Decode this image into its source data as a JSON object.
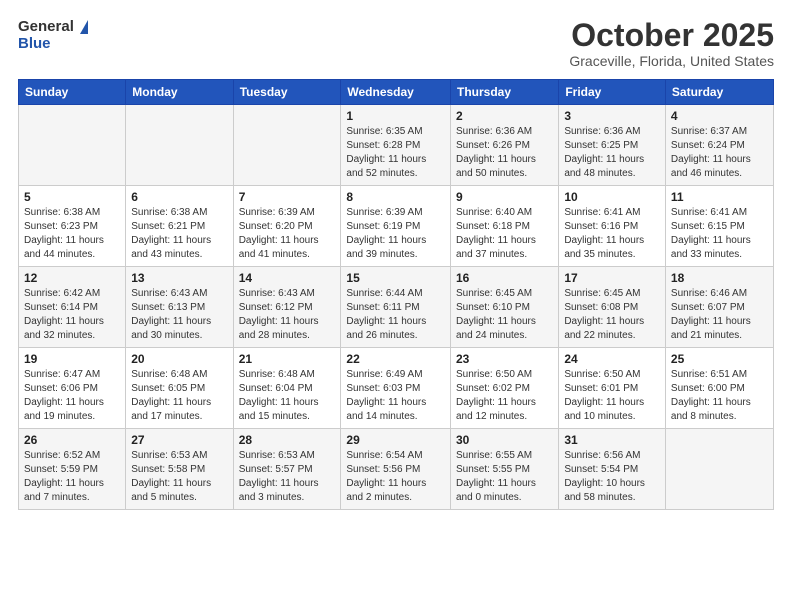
{
  "header": {
    "logo_general": "General",
    "logo_blue": "Blue",
    "month": "October 2025",
    "location": "Graceville, Florida, United States"
  },
  "weekdays": [
    "Sunday",
    "Monday",
    "Tuesday",
    "Wednesday",
    "Thursday",
    "Friday",
    "Saturday"
  ],
  "weeks": [
    [
      {
        "day": "",
        "info": ""
      },
      {
        "day": "",
        "info": ""
      },
      {
        "day": "",
        "info": ""
      },
      {
        "day": "1",
        "info": "Sunrise: 6:35 AM\nSunset: 6:28 PM\nDaylight: 11 hours\nand 52 minutes."
      },
      {
        "day": "2",
        "info": "Sunrise: 6:36 AM\nSunset: 6:26 PM\nDaylight: 11 hours\nand 50 minutes."
      },
      {
        "day": "3",
        "info": "Sunrise: 6:36 AM\nSunset: 6:25 PM\nDaylight: 11 hours\nand 48 minutes."
      },
      {
        "day": "4",
        "info": "Sunrise: 6:37 AM\nSunset: 6:24 PM\nDaylight: 11 hours\nand 46 minutes."
      }
    ],
    [
      {
        "day": "5",
        "info": "Sunrise: 6:38 AM\nSunset: 6:23 PM\nDaylight: 11 hours\nand 44 minutes."
      },
      {
        "day": "6",
        "info": "Sunrise: 6:38 AM\nSunset: 6:21 PM\nDaylight: 11 hours\nand 43 minutes."
      },
      {
        "day": "7",
        "info": "Sunrise: 6:39 AM\nSunset: 6:20 PM\nDaylight: 11 hours\nand 41 minutes."
      },
      {
        "day": "8",
        "info": "Sunrise: 6:39 AM\nSunset: 6:19 PM\nDaylight: 11 hours\nand 39 minutes."
      },
      {
        "day": "9",
        "info": "Sunrise: 6:40 AM\nSunset: 6:18 PM\nDaylight: 11 hours\nand 37 minutes."
      },
      {
        "day": "10",
        "info": "Sunrise: 6:41 AM\nSunset: 6:16 PM\nDaylight: 11 hours\nand 35 minutes."
      },
      {
        "day": "11",
        "info": "Sunrise: 6:41 AM\nSunset: 6:15 PM\nDaylight: 11 hours\nand 33 minutes."
      }
    ],
    [
      {
        "day": "12",
        "info": "Sunrise: 6:42 AM\nSunset: 6:14 PM\nDaylight: 11 hours\nand 32 minutes."
      },
      {
        "day": "13",
        "info": "Sunrise: 6:43 AM\nSunset: 6:13 PM\nDaylight: 11 hours\nand 30 minutes."
      },
      {
        "day": "14",
        "info": "Sunrise: 6:43 AM\nSunset: 6:12 PM\nDaylight: 11 hours\nand 28 minutes."
      },
      {
        "day": "15",
        "info": "Sunrise: 6:44 AM\nSunset: 6:11 PM\nDaylight: 11 hours\nand 26 minutes."
      },
      {
        "day": "16",
        "info": "Sunrise: 6:45 AM\nSunset: 6:10 PM\nDaylight: 11 hours\nand 24 minutes."
      },
      {
        "day": "17",
        "info": "Sunrise: 6:45 AM\nSunset: 6:08 PM\nDaylight: 11 hours\nand 22 minutes."
      },
      {
        "day": "18",
        "info": "Sunrise: 6:46 AM\nSunset: 6:07 PM\nDaylight: 11 hours\nand 21 minutes."
      }
    ],
    [
      {
        "day": "19",
        "info": "Sunrise: 6:47 AM\nSunset: 6:06 PM\nDaylight: 11 hours\nand 19 minutes."
      },
      {
        "day": "20",
        "info": "Sunrise: 6:48 AM\nSunset: 6:05 PM\nDaylight: 11 hours\nand 17 minutes."
      },
      {
        "day": "21",
        "info": "Sunrise: 6:48 AM\nSunset: 6:04 PM\nDaylight: 11 hours\nand 15 minutes."
      },
      {
        "day": "22",
        "info": "Sunrise: 6:49 AM\nSunset: 6:03 PM\nDaylight: 11 hours\nand 14 minutes."
      },
      {
        "day": "23",
        "info": "Sunrise: 6:50 AM\nSunset: 6:02 PM\nDaylight: 11 hours\nand 12 minutes."
      },
      {
        "day": "24",
        "info": "Sunrise: 6:50 AM\nSunset: 6:01 PM\nDaylight: 11 hours\nand 10 minutes."
      },
      {
        "day": "25",
        "info": "Sunrise: 6:51 AM\nSunset: 6:00 PM\nDaylight: 11 hours\nand 8 minutes."
      }
    ],
    [
      {
        "day": "26",
        "info": "Sunrise: 6:52 AM\nSunset: 5:59 PM\nDaylight: 11 hours\nand 7 minutes."
      },
      {
        "day": "27",
        "info": "Sunrise: 6:53 AM\nSunset: 5:58 PM\nDaylight: 11 hours\nand 5 minutes."
      },
      {
        "day": "28",
        "info": "Sunrise: 6:53 AM\nSunset: 5:57 PM\nDaylight: 11 hours\nand 3 minutes."
      },
      {
        "day": "29",
        "info": "Sunrise: 6:54 AM\nSunset: 5:56 PM\nDaylight: 11 hours\nand 2 minutes."
      },
      {
        "day": "30",
        "info": "Sunrise: 6:55 AM\nSunset: 5:55 PM\nDaylight: 11 hours\nand 0 minutes."
      },
      {
        "day": "31",
        "info": "Sunrise: 6:56 AM\nSunset: 5:54 PM\nDaylight: 10 hours\nand 58 minutes."
      },
      {
        "day": "",
        "info": ""
      }
    ]
  ]
}
